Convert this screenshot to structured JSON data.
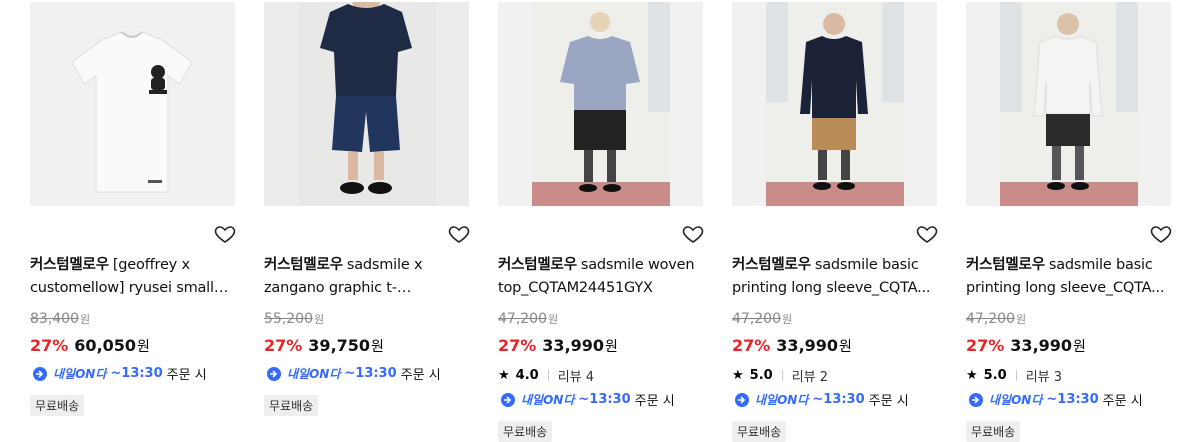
{
  "products": [
    {
      "brand": "커스텀멜로우",
      "name": "[geoffrey x customellow] ryusei small artw...",
      "original_price": "83,400",
      "discount": "27%",
      "price": "60,050",
      "currency": "원",
      "delivery_brand": "내일ON다",
      "delivery_time": "~13:30",
      "delivery_text": "주문 시",
      "shipping_badge": "무료배송"
    },
    {
      "brand": "커스텀멜로우",
      "name": "sadsmile x zangano graphic t-shirt_CQTA...",
      "original_price": "55,200",
      "discount": "27%",
      "price": "39,750",
      "currency": "원",
      "delivery_brand": "내일ON다",
      "delivery_time": "~13:30",
      "delivery_text": "주문 시",
      "shipping_badge": "무료배송"
    },
    {
      "brand": "커스텀멜로우",
      "name": "sadsmile woven top_CQTAM24451GYX",
      "original_price": "47,200",
      "discount": "27%",
      "price": "33,990",
      "currency": "원",
      "rating": "4.0",
      "reviews": "리뷰 4",
      "delivery_brand": "내일ON다",
      "delivery_time": "~13:30",
      "delivery_text": "주문 시",
      "shipping_badge": "무료배송"
    },
    {
      "brand": "커스텀멜로우",
      "name": "sadsmile basic printing long sleeve_CQTA...",
      "original_price": "47,200",
      "discount": "27%",
      "price": "33,990",
      "currency": "원",
      "rating": "5.0",
      "reviews": "리뷰 2",
      "delivery_brand": "내일ON다",
      "delivery_time": "~13:30",
      "delivery_text": "주문 시",
      "shipping_badge": "무료배송"
    },
    {
      "brand": "커스텀멜로우",
      "name": "sadsmile basic printing long sleeve_CQTA...",
      "original_price": "47,200",
      "discount": "27%",
      "price": "33,990",
      "currency": "원",
      "rating": "5.0",
      "reviews": "리뷰 3",
      "delivery_brand": "내일ON다",
      "delivery_time": "~13:30",
      "delivery_text": "주문 시",
      "shipping_badge": "무료배송"
    }
  ],
  "colors": {
    "discount": "#e52528",
    "delivery": "#346aff",
    "badge_bg": "#eeeeee"
  },
  "icons": {
    "wishlist": "heart-outline-icon",
    "rating": "star-icon",
    "delivery": "delivery-truck-icon"
  }
}
